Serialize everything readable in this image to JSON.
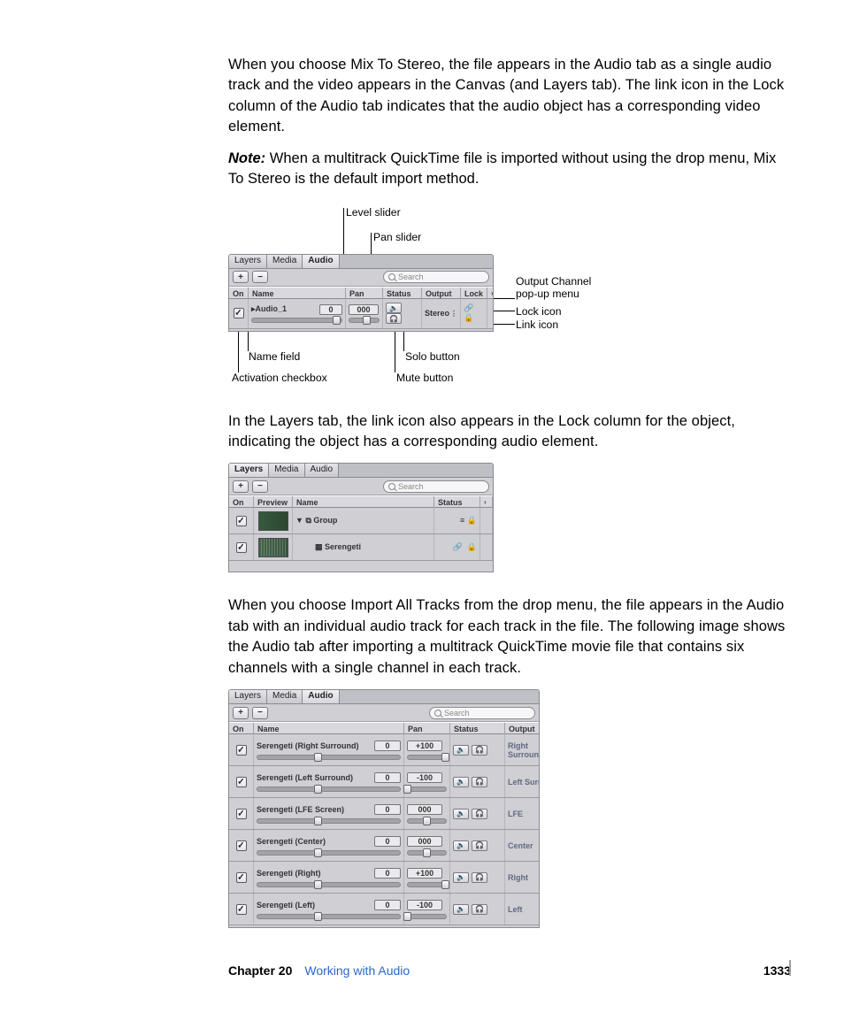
{
  "paragraphs": {
    "p1": "When you choose Mix To Stereo, the file appears in the Audio tab as a single audio track and the video appears in the Canvas (and Layers tab). The link icon in the Lock column of the Audio tab indicates that the audio object has a corresponding video element.",
    "noteLabel": "Note:",
    "note": "When a multitrack QuickTime file is imported without using the drop menu, Mix To Stereo is the default import method.",
    "p2": "In the Layers tab, the link icon also appears in the Lock column for the object, indicating the object has a corresponding audio element.",
    "p3": "When you choose Import All Tracks from the drop menu, the file appears in the Audio tab with an individual audio track for each track in the file. The following image shows the Audio tab after importing a multitrack QuickTime movie file that contains six channels with a single channel in each track."
  },
  "callouts": {
    "levelSlider": "Level slider",
    "panSlider": "Pan slider",
    "outputCh": "Output Channel pop-up menu",
    "lockIcon": "Lock icon",
    "linkIcon": "Link icon",
    "nameField": "Name field",
    "soloBtn": "Solo button",
    "actCb": "Activation checkbox",
    "muteBtn": "Mute button"
  },
  "ui": {
    "tabs": {
      "layers": "Layers",
      "media": "Media",
      "audio": "Audio"
    },
    "searchPlaceholder": "Search",
    "plus": "+",
    "minus": "−",
    "audioCols": {
      "on": "On",
      "name": "Name",
      "pan": "Pan",
      "status": "Status",
      "output": "Output",
      "lock": "Lock"
    },
    "layersCols": {
      "on": "On",
      "preview": "Preview",
      "name": "Name",
      "status": "Status"
    },
    "fig1Row": {
      "name": "Audio_1",
      "level": "0",
      "pan": "000",
      "output": "Stereo",
      "speakerGlyph": "🔈",
      "headGlyph": "🎧",
      "linkGlyph": "🔗",
      "lockGlyph": "🔒",
      "caretGlyph": "▸"
    },
    "fig2Rows": {
      "r1": {
        "name": "Group",
        "status1": "≡",
        "link": "🔗",
        "lock": "🔒",
        "caret": "▼",
        "grpGlyph": "⧉"
      },
      "r2": {
        "name": "Serengeti",
        "link": "🔗",
        "lock": "🔒",
        "clip": "▦"
      }
    },
    "fig3Rows": [
      {
        "name": "Serengeti (Right Surround)",
        "level": "0",
        "pan": "+100",
        "output": "Right Surround",
        "knob": 100
      },
      {
        "name": "Serengeti (Left Surround)",
        "level": "0",
        "pan": "-100",
        "output": "Left Surround",
        "knob": 0
      },
      {
        "name": "Serengeti (LFE Screen)",
        "level": "0",
        "pan": "000",
        "output": "LFE",
        "knob": 50
      },
      {
        "name": "Serengeti (Center)",
        "level": "0",
        "pan": "000",
        "output": "Center",
        "knob": 50
      },
      {
        "name": "Serengeti (Right)",
        "level": "0",
        "pan": "+100",
        "output": "Right",
        "knob": 100
      },
      {
        "name": "Serengeti (Left)",
        "level": "0",
        "pan": "-100",
        "output": "Left",
        "knob": 0
      }
    ],
    "checkGlyph": "✓",
    "rowPopup": "⋮"
  },
  "footer": {
    "chapter": "Chapter 20",
    "title": "Working with Audio",
    "page": "1333"
  }
}
